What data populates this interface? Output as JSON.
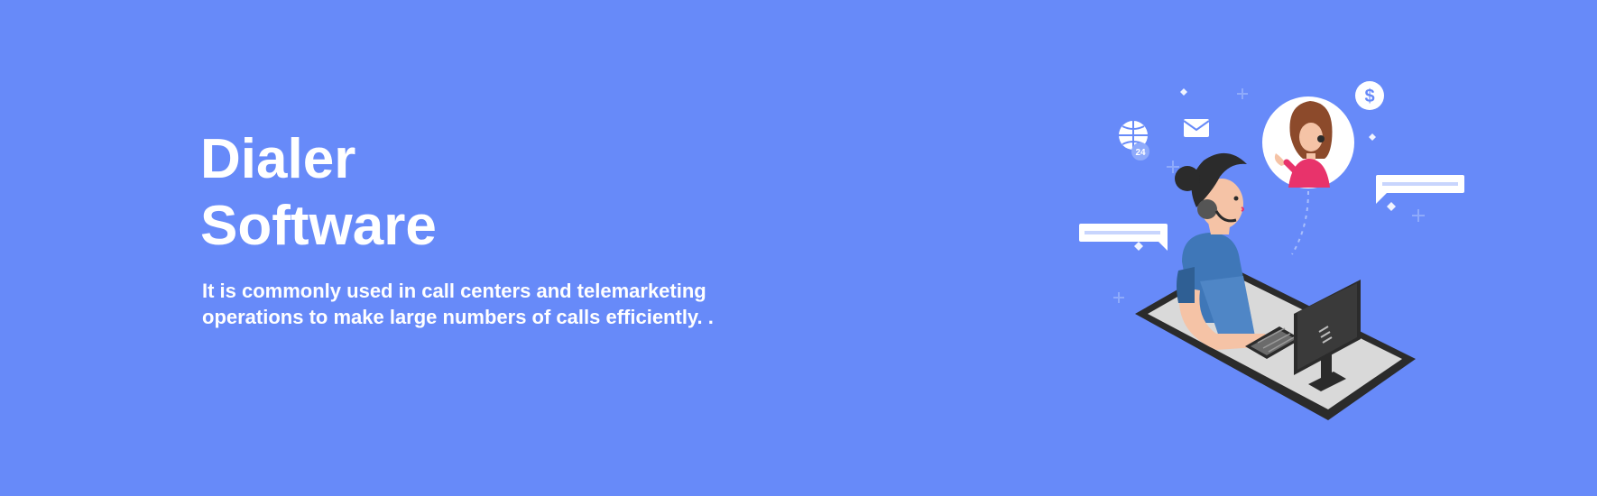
{
  "hero": {
    "title_line1": "Dialer",
    "title_line2": "Software",
    "description": "It is commonly used in call centers and telemarketing operations to make large numbers of calls efficiently. ."
  },
  "illustration": {
    "icons": [
      "globe-24-icon",
      "envelope-icon",
      "dollar-coin-icon",
      "chat-bubble-icon",
      "headset-icon",
      "computer-monitor-icon",
      "keyboard-icon"
    ],
    "globe_badge": "24",
    "dollar_symbol": "$"
  },
  "colors": {
    "background": "#678af9",
    "text": "#ffffff",
    "agent_shirt": "#4f86c6",
    "client_shirt": "#e8336b",
    "device": "#2b2b2b"
  }
}
